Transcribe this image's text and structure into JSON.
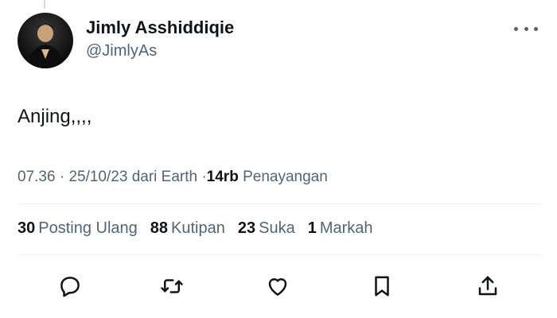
{
  "tweet": {
    "author": {
      "display_name": "Jimly Asshiddiqie",
      "handle": "@JimlyAs"
    },
    "text": "Anjing,,,,",
    "meta": {
      "time": "07.36",
      "separator": "·",
      "date": "25/10/23",
      "source": "dari Earth",
      "views_count": "14rb",
      "views_label": "Penayangan"
    },
    "stats": {
      "reposts": {
        "count": "30",
        "label": "Posting Ulang"
      },
      "quotes": {
        "count": "88",
        "label": "Kutipan"
      },
      "likes": {
        "count": "23",
        "label": "Suka"
      },
      "bookmarks": {
        "count": "1",
        "label": "Markah"
      }
    }
  },
  "icons": {
    "more": "more-options-icon",
    "reply": "reply-icon",
    "repost": "repost-icon",
    "like": "like-icon",
    "bookmark": "bookmark-icon",
    "share": "share-icon"
  },
  "colors": {
    "text": "#0f1419",
    "secondary": "#536471",
    "divider": "#eff3f4"
  }
}
